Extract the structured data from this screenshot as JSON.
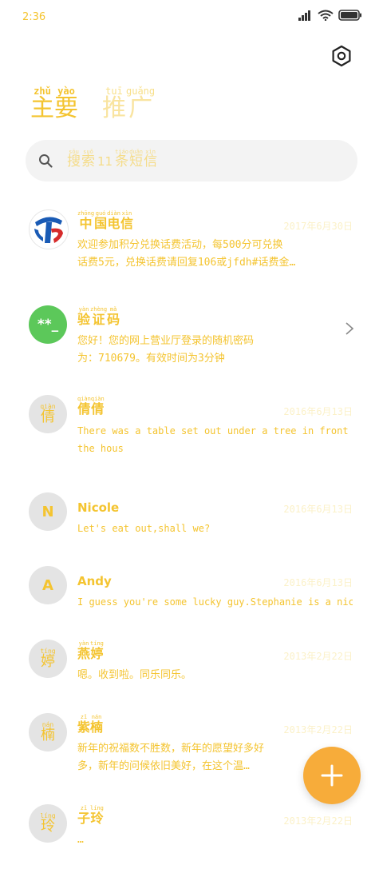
{
  "status": {
    "time": "2:36"
  },
  "title": {
    "main": [
      {
        "py": "zhǔ",
        "hz": "主"
      },
      {
        "py": "yào",
        "hz": "要"
      }
    ],
    "sub": [
      {
        "py": "tuī",
        "hz": "推"
      },
      {
        "py": "guǎng",
        "hz": "广"
      }
    ]
  },
  "search": {
    "pre": [
      {
        "py": "sōu",
        "hz": "搜"
      },
      {
        "py": "suǒ",
        "hz": "索"
      }
    ],
    "count": "11",
    "post": [
      {
        "py": "tiáo",
        "hz": "条"
      },
      {
        "py": "duǎn",
        "hz": "短"
      },
      {
        "py": "xìn",
        "hz": "信"
      }
    ]
  },
  "messages": [
    {
      "avatar_type": "telecom",
      "name_ruby": [
        {
          "py": "zhōng",
          "hz": "中"
        },
        {
          "py": "guó",
          "hz": "国"
        },
        {
          "py": "diàn",
          "hz": "电"
        },
        {
          "py": "xìn",
          "hz": "信"
        }
      ],
      "date": "2017年6月30日",
      "preview": [
        "欢迎参加积分兑换话费活动，每500分可兑换",
        "话费5元，兑换话费请回复106或jfdh#话费金…"
      ]
    },
    {
      "avatar_type": "code",
      "avatar_text": "**_",
      "name_ruby": [
        {
          "py": "yàn",
          "hz": "验"
        },
        {
          "py": "zhèng",
          "hz": "证"
        },
        {
          "py": "mǎ",
          "hz": "码"
        }
      ],
      "date": "",
      "preview": [
        "您好！您的网上营业厅登录的随机密码",
        "为：710679。有效时间为3分钟"
      ]
    },
    {
      "avatar_type": "ruby",
      "avatar_ruby": {
        "py": "qiàn",
        "hz": "倩"
      },
      "name_ruby": [
        {
          "py": "qiàn",
          "hz": "倩"
        },
        {
          "py": "qiàn",
          "hz": "倩"
        }
      ],
      "date": "2016年6月13日",
      "preview": [
        "There was a table set out under a tree in front of",
        "the hous"
      ]
    },
    {
      "avatar_type": "letter",
      "avatar_text": "N",
      "name_text": "Nicole",
      "date": "2016年6月13日",
      "preview": [
        "Let's eat out,shall we?"
      ]
    },
    {
      "avatar_type": "letter",
      "avatar_text": "A",
      "name_text": "Andy",
      "date": "2016年6月13日",
      "preview": [
        "I guess you're some lucky guy.Stephanie is a nice girl."
      ]
    },
    {
      "avatar_type": "ruby",
      "avatar_ruby": {
        "py": "tíng",
        "hz": "婷"
      },
      "name_ruby": [
        {
          "py": "yàn",
          "hz": "燕"
        },
        {
          "py": "tíng",
          "hz": "婷"
        }
      ],
      "date": "2013年2月22日",
      "preview": [
        "嗯。收到啦。同乐同乐。"
      ]
    },
    {
      "avatar_type": "ruby",
      "avatar_ruby": {
        "py": "nán",
        "hz": "楠"
      },
      "name_ruby": [
        {
          "py": "zǐ",
          "hz": "紫"
        },
        {
          "py": "nán",
          "hz": "楠"
        }
      ],
      "date": "2013年2月22日",
      "preview": [
        "新年的祝福数不胜数，新年的愿望好多好",
        "多，新年的问候依旧美好，在这个温…"
      ]
    },
    {
      "avatar_type": "ruby",
      "avatar_ruby": {
        "py": "líng",
        "hz": "玲"
      },
      "name_ruby": [
        {
          "py": "zǐ",
          "hz": "子"
        },
        {
          "py": "líng",
          "hz": "玲"
        }
      ],
      "date": "2013年2月22日",
      "preview": [
        "…"
      ]
    }
  ],
  "colors": {
    "accent": "#f4c430",
    "fab": "#f7ac3a",
    "avatar_bg": "#e4e4e4",
    "code_avatar": "#5cc85a",
    "telecom_blue": "#1a5bb5"
  },
  "fab": {
    "icon": "plus-icon"
  }
}
